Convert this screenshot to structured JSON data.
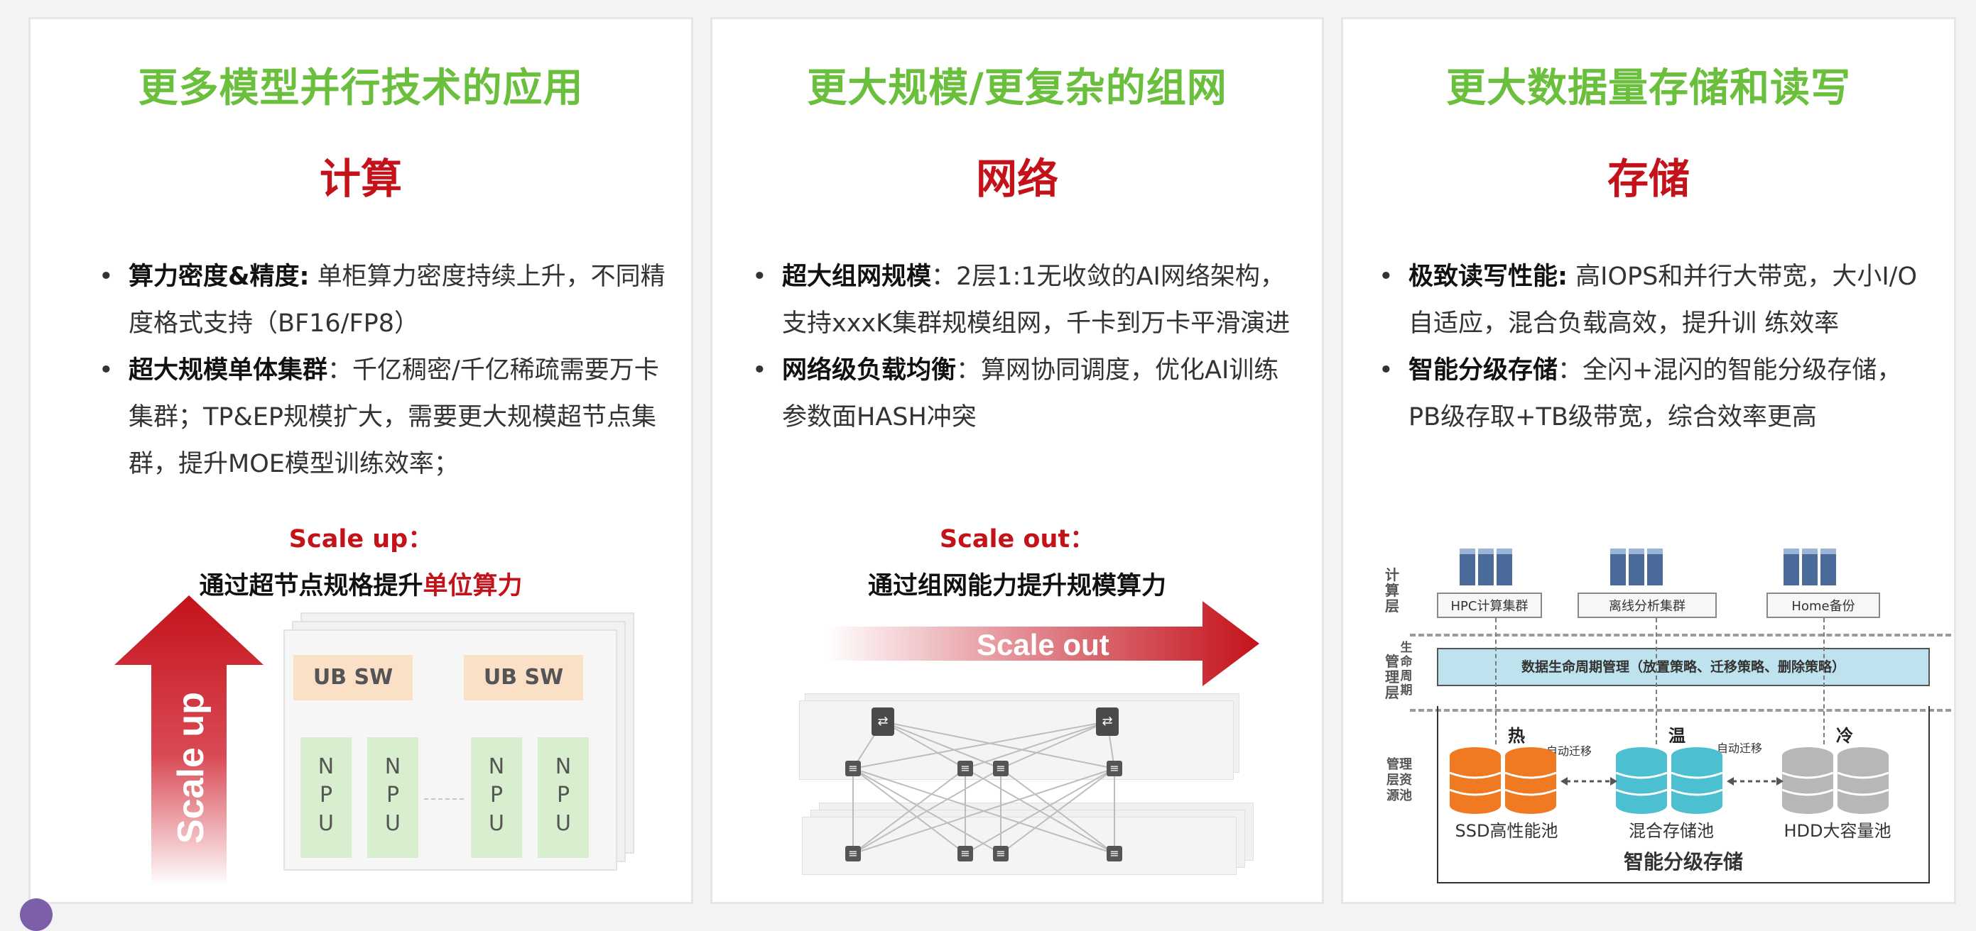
{
  "panels": [
    {
      "headline": "更多模型并行技术的应用",
      "category": "计算",
      "bullets": [
        {
          "bold": "算力密度&精度:",
          "text": "单柜算力密度持续上升，不同精度格式支持（BF16/FP8）"
        },
        {
          "bold": "超大规模单体集群",
          "text": "：千亿稠密/千亿稀疏需要万卡集群；TP&EP规模扩大，需要更大规模超节点集群，提升MOE模型训练效率；"
        }
      ],
      "sub_title": "Scale up：",
      "sub_text": "通过超节点规格提升",
      "sub_text_red": "单位算力",
      "arrow_label": "Scale up",
      "diagram": {
        "switch_label": "UB  SW",
        "npu_letters": [
          "N",
          "P",
          "U"
        ]
      }
    },
    {
      "headline": "更大规模/更复杂的组网",
      "category": "网络",
      "bullets": [
        {
          "bold": "超大组网规模",
          "text": "：2层1:1无收敛的AI网络架构，支持xxxK集群规模组网，千卡到万卡平滑演进"
        },
        {
          "bold": "网络级负载均衡",
          "text": "：算网协同调度，优化AI训练参数面HASH冲突"
        }
      ],
      "sub_title": "Scale out：",
      "sub_text": "通过组网能力提升规模算力",
      "arrow_label": "Scale out"
    },
    {
      "headline": "更大数据量存储和读写",
      "category": "存储",
      "bullets": [
        {
          "bold": "极致读写性能:",
          "text": "高IOPS和并行大带宽，大小I/O自适应，混合负载高效，提升训    练效率"
        },
        {
          "bold": "智能分级存储",
          "text": "：全闪+混闪的智能分级存储，PB级存取+TB级带宽，综合效率更高"
        }
      ],
      "diagram": {
        "layer_compute": "计算层",
        "layer_mgmt": "管理层",
        "layer_life": "生命周期",
        "layer_pool": "管理层资源池",
        "servers": [
          "HPC计算集群",
          "离线分析集群",
          "Home备份"
        ],
        "lifecycle": "数据生命周期管理（放置策略、迁移策略、删除策略）",
        "tiers": [
          "热",
          "温",
          "冷"
        ],
        "migration": "自动迁移",
        "pools": [
          "SSD高性能池",
          "混合存储池",
          "HDD大容量池"
        ],
        "pool_title": "智能分级存储"
      }
    }
  ],
  "colors": {
    "headline": "#6abf3c",
    "accent_red": "#c4121a",
    "ssd": "#f07a22",
    "hybrid": "#4cc0d0",
    "hdd": "#b7b7b7"
  }
}
